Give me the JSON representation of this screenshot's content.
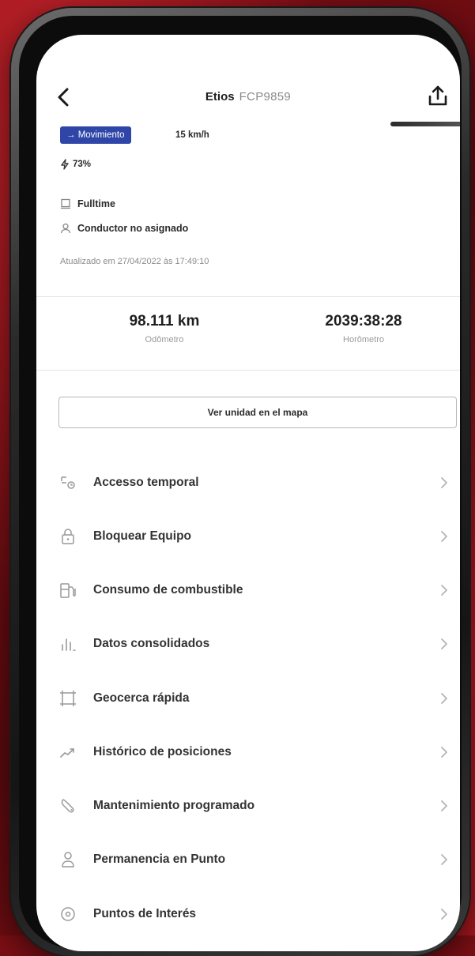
{
  "header": {
    "title": "Etios",
    "plate": "FCP9859"
  },
  "status": {
    "badge": "→ Movimiento",
    "speed": "15 km/h",
    "battery": "73%"
  },
  "info": {
    "tracking": "Fulltime",
    "driver": "Conductor no asignado",
    "updated": "Atualizado em 27/04/2022 às 17:49:10"
  },
  "stats": {
    "odometer_value": "98.111 km",
    "odometer_label": "Odômetro",
    "hourmeter_value": "2039:38:28",
    "hourmeter_label": "Horômetro"
  },
  "map_button": "Ver unidad en el mapa",
  "menu": {
    "items": [
      {
        "label": "Accesso temporal",
        "icon": "temporary-access-icon"
      },
      {
        "label": "Bloquear Equipo",
        "icon": "lock-icon"
      },
      {
        "label": "Consumo de combustible",
        "icon": "fuel-icon"
      },
      {
        "label": "Datos consolidados",
        "icon": "bar-chart-icon"
      },
      {
        "label": "Geocerca rápida",
        "icon": "geofence-icon"
      },
      {
        "label": "Histórico de posiciones",
        "icon": "trend-icon"
      },
      {
        "label": "Mantenimiento programado",
        "icon": "maintenance-icon"
      },
      {
        "label": "Permanencia en Punto",
        "icon": "person-pin-icon"
      },
      {
        "label": "Puntos de Interés",
        "icon": "target-icon"
      }
    ]
  },
  "colors": {
    "badge_bg": "#2f46a8",
    "background": "#8e1118"
  }
}
